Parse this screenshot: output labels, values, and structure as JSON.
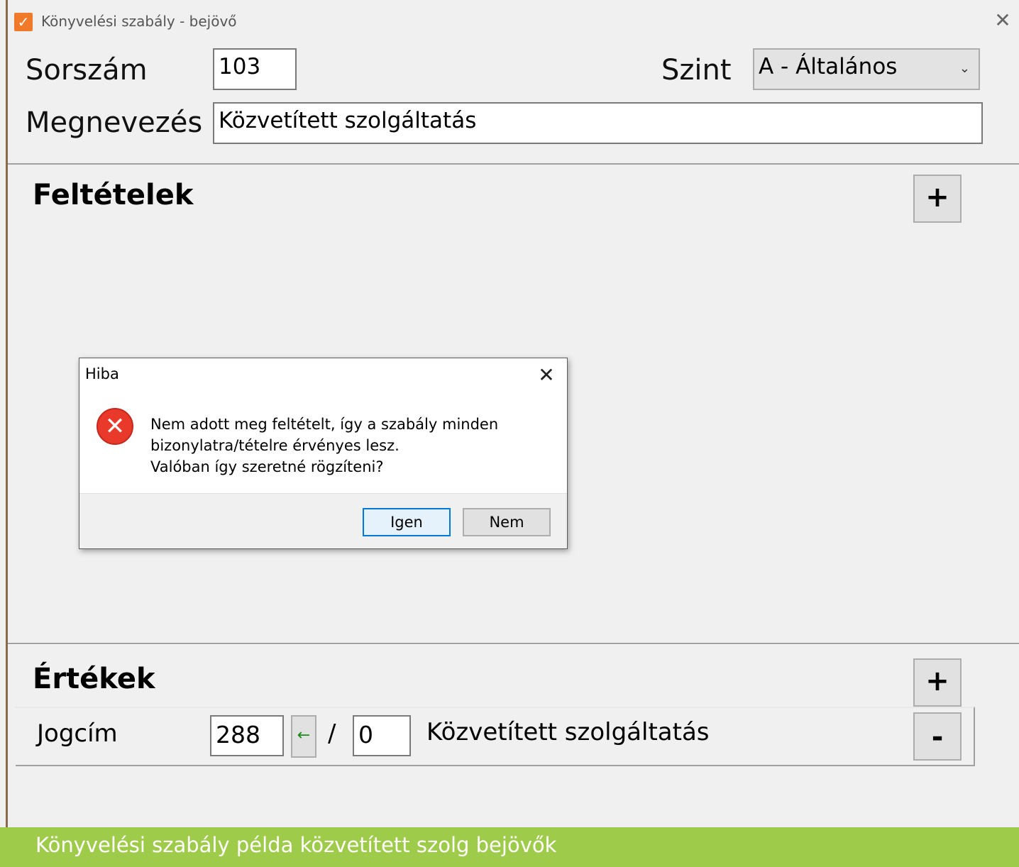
{
  "window": {
    "title": "Könyvelési szabály - bejövő",
    "close_glyph": "✕",
    "icon": "checkmark-icon"
  },
  "header": {
    "sorszam_label": "Sorszám",
    "sorszam_value": "103",
    "szint_label": "Szint",
    "szint_value": "A - Általános",
    "megnevezes_label": "Megnevezés",
    "megnevezes_value": "Közvetített szolgáltatás"
  },
  "conditions": {
    "title": "Feltételek",
    "add_label": "+"
  },
  "dialog": {
    "title": "Hiba",
    "close_glyph": "✕",
    "icon": "error-icon",
    "message_line1": "Nem adott meg feltételt, így a szabály minden",
    "message_line2": "bizonylatra/tételre érvényes lesz.",
    "message_line3": "Valóban így szeretné rögzíteni?",
    "yes_label": "Igen",
    "no_label": "Nem"
  },
  "values": {
    "title": "Értékek",
    "add_label": "+",
    "row": {
      "label": "Jogcím",
      "code": "288",
      "arrow_glyph": "←",
      "slash": "/",
      "sub_code": "0",
      "name": "Közvetített szolgáltatás",
      "remove_label": "-"
    }
  },
  "caption": "Könyvelési szabály példa közvetített szolg bejövők",
  "colors": {
    "caption_bg": "#9fcb4a",
    "app_icon": "#f07a2a",
    "error_red": "#e8392b",
    "default_button_border": "#0078d7"
  }
}
